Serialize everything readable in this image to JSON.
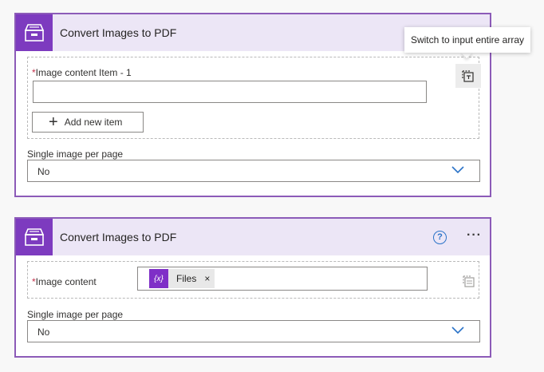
{
  "colors": {
    "accent": "#7d3bbf",
    "card_border": "#8c5bb8",
    "header_bg": "#ece6f6",
    "help": "#2b73c8",
    "required": "#c4314b"
  },
  "card1": {
    "title": "Convert Images to PDF",
    "action_icon": "archive-box-icon",
    "field_label": "Image content Item - 1",
    "required_mark": "*",
    "input_value": "",
    "add_button_label": "Add new item",
    "array_button_icon": "switch-array-icon",
    "single_image_label": "Single image per page",
    "single_image_value": "No"
  },
  "card2": {
    "title": "Convert Images to PDF",
    "action_icon": "archive-box-icon",
    "help_icon": "?",
    "more_icon": "···",
    "field_label": "Image content",
    "required_mark": "*",
    "token_icon_text": "{x}",
    "token_label": "Files",
    "token_remove": "×",
    "single_image_label": "Single image per page",
    "single_image_value": "No"
  },
  "tooltip": {
    "text": "Switch to input entire array"
  }
}
